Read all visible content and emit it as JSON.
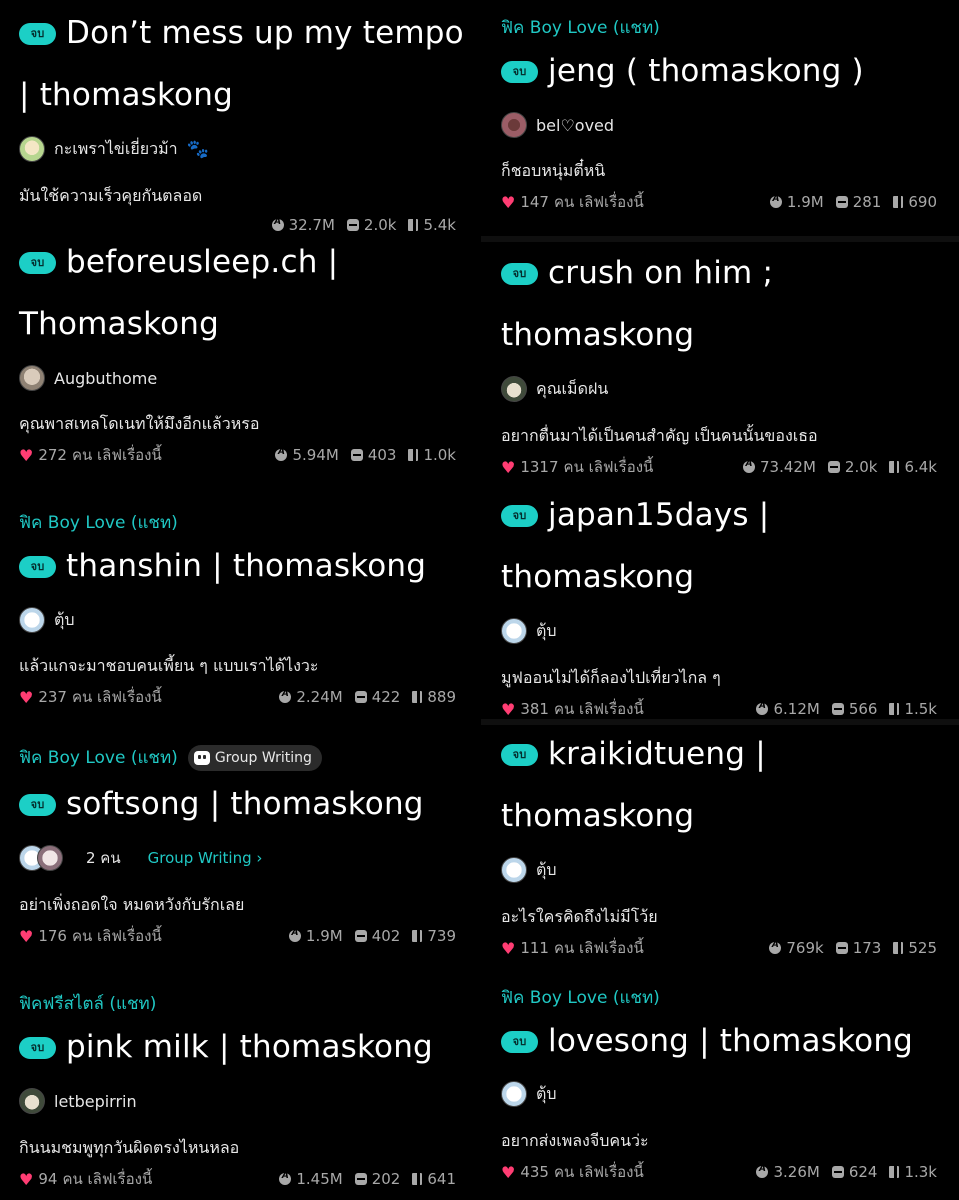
{
  "badge_label": "จบ",
  "love_suffix": "คน เลิฟเรื่องนี้",
  "left": [
    {
      "category": "",
      "title": "Don’t mess up my tempo | thomaskong",
      "author": "กะเพราไข่เยี่ยวม้า",
      "description": "มันใช้ความเร็วคุยกันตลอด",
      "likes": "",
      "reads": "32.7M",
      "comments": "2.0k",
      "chapters": "5.4k"
    },
    {
      "category": "",
      "title": "beforeusleep.ch | Thomaskong",
      "author": "Augbuthome",
      "description": "คุณพาสเทลโดเนทให้มึงอีกแล้วหรอ",
      "likes": "272",
      "reads": "5.94M",
      "comments": "403",
      "chapters": "1.0k"
    },
    {
      "category": "ฟิค Boy Love (แชท)",
      "title": "thanshin | thomaskong",
      "author": "ตุ้บ",
      "description": "แล้วแกจะมาชอบคนเพี้ยน ๆ แบบเราได้ไงวะ",
      "likes": "237",
      "reads": "2.24M",
      "comments": "422",
      "chapters": "889"
    },
    {
      "category": "ฟิค Boy Love (แชท)",
      "group_chip": "Group Writing",
      "title": "softsong | thomaskong",
      "author_count": "2 คน",
      "group_link": "Group Writing ›",
      "description": "อย่าเพิ่งถอดใจ หมดหวังกับรักเลย",
      "likes": "176",
      "reads": "1.9M",
      "comments": "402",
      "chapters": "739"
    },
    {
      "category": "ฟิคฟรีสไตล์ (แชท)",
      "title": "pink milk | thomaskong",
      "author": "letbepirrin",
      "description": "กินนมชมพูทุกวันผิดตรงไหนหลอ",
      "likes": "94",
      "reads": "1.45M",
      "comments": "202",
      "chapters": "641"
    }
  ],
  "right": [
    {
      "category": "ฟิค Boy Love (แชท)",
      "title": "jeng ( thomaskong )",
      "author": "bel♡oved",
      "description": "ก็ชอบหนุ่มตี๋หนิ",
      "likes": "147",
      "reads": "1.9M",
      "comments": "281",
      "chapters": "690"
    },
    {
      "category": "",
      "title": "crush on him ; thomaskong",
      "author": "คุณเม็ดฝน",
      "description": "อยากตื่นมาได้เป็นคนสำคัญ เป็นคนนั้นของเธอ",
      "likes": "1317",
      "reads": "73.42M",
      "comments": "2.0k",
      "chapters": "6.4k"
    },
    {
      "category": "",
      "title": "japan15days | thomaskong",
      "author": "ตุ้บ",
      "description": "มูฟออนไม่ได้ก็ลองไปเที่ยวไกล ๆ",
      "likes": "381",
      "reads": "6.12M",
      "comments": "566",
      "chapters": "1.5k"
    },
    {
      "category": "",
      "title": "kraikidtueng | thomaskong",
      "author": "ตุ้บ",
      "description": "อะไรใครคิดถึงไม่มีโว้ย",
      "likes": "111",
      "reads": "769k",
      "comments": "173",
      "chapters": "525"
    },
    {
      "category": "ฟิค Boy Love (แชท)",
      "title": "lovesong | thomaskong",
      "author": "ตุ้บ",
      "description": "อยากส่งเพลงจีบคนว่ะ",
      "likes": "435",
      "reads": "3.26M",
      "comments": "624",
      "chapters": "1.3k"
    }
  ]
}
